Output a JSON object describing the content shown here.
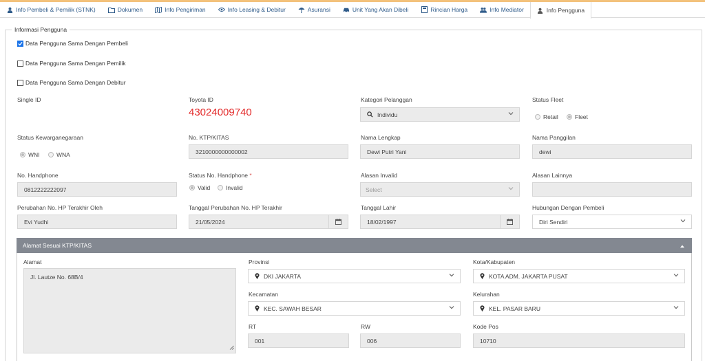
{
  "tabs": [
    {
      "label": "Info Pembeli & Pemilik (STNK)",
      "icon": "user-icon"
    },
    {
      "label": "Dokumen",
      "icon": "folder-icon"
    },
    {
      "label": "Info Pengiriman",
      "icon": "map-icon"
    },
    {
      "label": "Info Leasing & Debitur",
      "icon": "eye-icon"
    },
    {
      "label": "Asuransi",
      "icon": "umbrella-icon"
    },
    {
      "label": "Unit Yang Akan Dibeli",
      "icon": "car-icon"
    },
    {
      "label": "Rincian Harga",
      "icon": "calculator-icon"
    },
    {
      "label": "Info Mediator",
      "icon": "users-icon"
    },
    {
      "label": "Info Pengguna",
      "icon": "user-icon"
    }
  ],
  "active_tab": "Info Pengguna",
  "section_title": "Informasi Pengguna",
  "checkboxes": [
    {
      "label": "Data Pengguna Sama Dengan Pembeli",
      "checked": true
    },
    {
      "label": "Data Pengguna Sama Dengan Pemilik",
      "checked": false
    },
    {
      "label": "Data Pengguna Sama Dengan Debitur",
      "checked": false
    }
  ],
  "fields": {
    "single_id_label": "Single ID",
    "toyota_id_label": "Toyota ID",
    "toyota_id_value": "43024009740",
    "kategori_label": "Kategori Pelanggan",
    "kategori_value": "Individu",
    "status_fleet_label": "Status Fleet",
    "status_fleet_options": [
      "Retail",
      "Fleet"
    ],
    "kewarganegaraan_label": "Status Kewarganegaraan",
    "kewarganegaraan_options": [
      "WNI",
      "WNA"
    ],
    "ktp_label": "No. KTP/KITAS",
    "ktp_value": "3210000000000002",
    "nama_lengkap_label": "Nama Lengkap",
    "nama_lengkap_value": "Dewi Putri Yani",
    "nama_panggilan_label": "Nama Panggilan",
    "nama_panggilan_value": "dewi",
    "handphone_label": "No. Handphone",
    "handphone_value": "0812222222097",
    "status_hp_label": "Status No. Handphone",
    "status_hp_required": "*",
    "status_hp_options": [
      "Valid",
      "Invalid"
    ],
    "alasan_invalid_label": "Alasan Invalid",
    "alasan_invalid_placeholder": "Select",
    "alasan_lainnya_label": "Alasan Lainnya",
    "perubahan_hp_label": "Perubahan No. HP Terakhir Oleh",
    "perubahan_hp_value": "Evi Yudhi",
    "tanggal_perubahan_label": "Tanggal Perubahan No. HP Terakhir",
    "tanggal_perubahan_value": "21/05/2024",
    "tanggal_lahir_label": "Tanggal Lahir",
    "tanggal_lahir_value": "18/02/1997",
    "hubungan_label": "Hubungan Dengan Pembeli",
    "hubungan_value": "Diri Sendiri"
  },
  "address": {
    "panel_title": "Alamat Sesuai KTP/KITAS",
    "alamat_label": "Alamat",
    "alamat_value": "Jl. Lautze No. 68B/4",
    "provinsi_label": "Provinsi",
    "provinsi_value": "DKI JAKARTA",
    "kota_label": "Kota/Kabupaten",
    "kota_value": "KOTA ADM. JAKARTA PUSAT",
    "kecamatan_label": "Kecamatan",
    "kecamatan_value": "KEC. SAWAH BESAR",
    "kelurahan_label": "Kelurahan",
    "kelurahan_value": "KEL. PASAR BARU",
    "rt_label": "RT",
    "rt_value": "001",
    "rw_label": "RW",
    "rw_value": "006",
    "kodepos_label": "Kode Pos",
    "kodepos_value": "10710"
  },
  "colors": {
    "tab_text": "#2f5b8a",
    "toyota_id": "#e32b2b",
    "panel_header": "#838891",
    "checkbox_checked": "#1a73e8"
  }
}
